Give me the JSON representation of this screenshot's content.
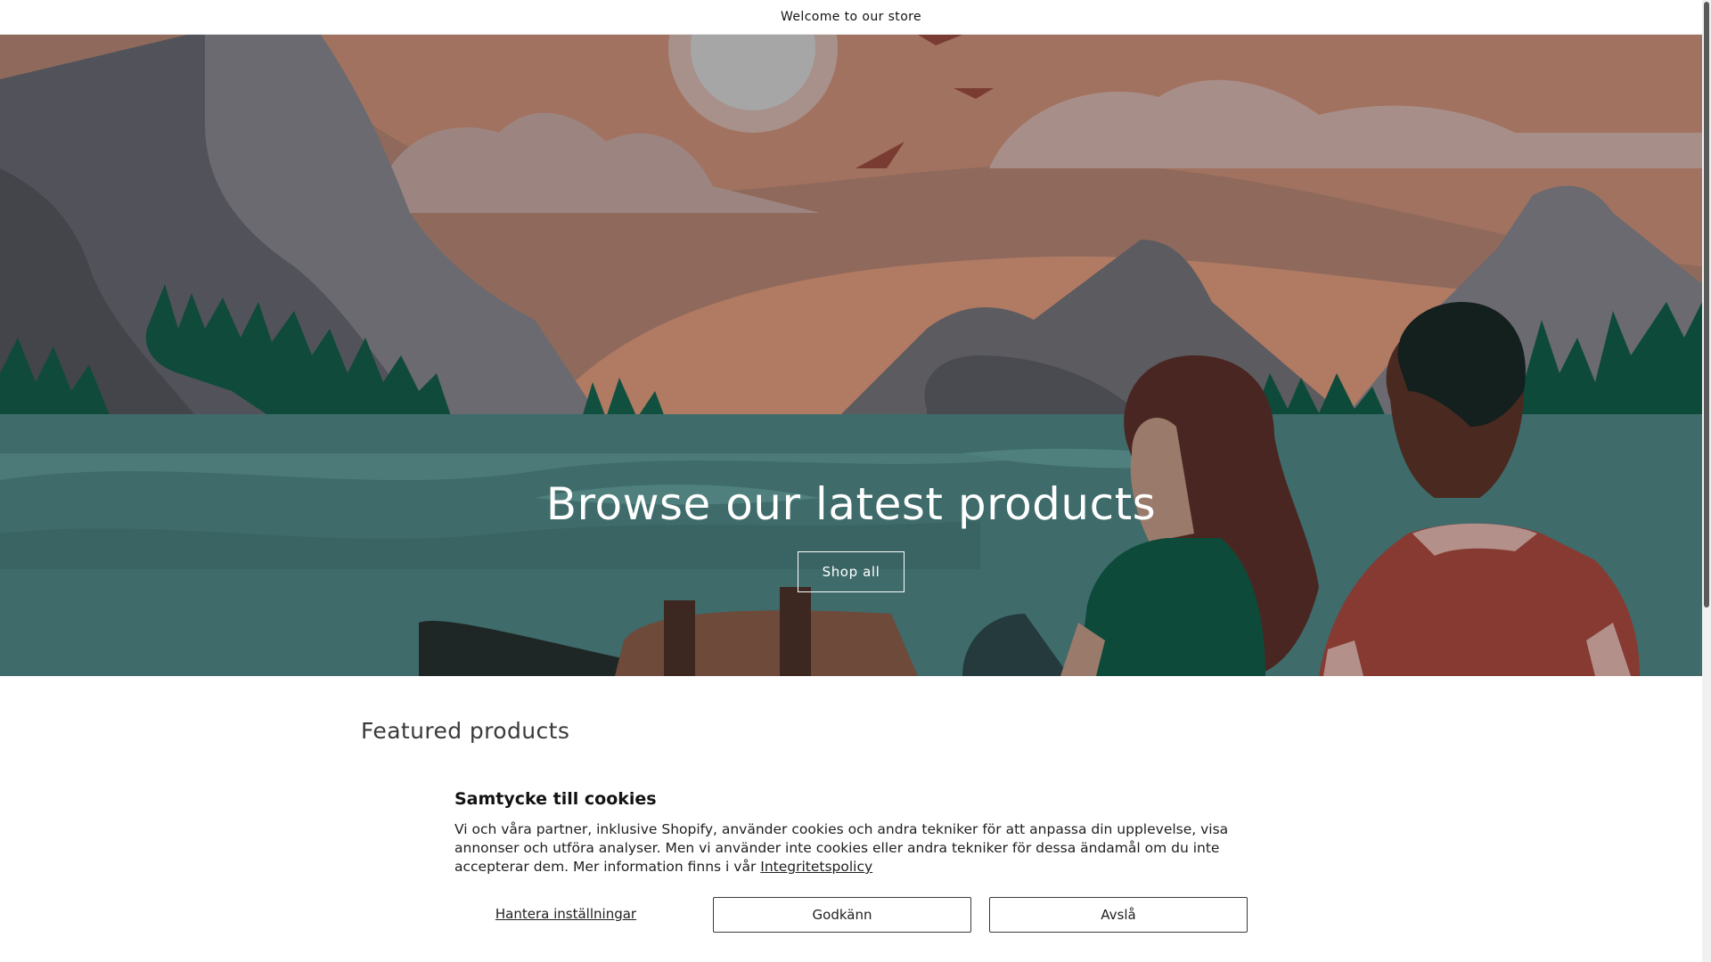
{
  "announcement": {
    "text": "Welcome to our store"
  },
  "hero": {
    "title": "Browse our latest products",
    "button_label": "Shop all"
  },
  "featured": {
    "heading": "Featured products"
  },
  "cookie_banner": {
    "title": "Samtycke till cookies",
    "body": "Vi och våra partner, inklusive Shopify, använder cookies och andra tekniker för att anpassa din upplevelse, visa annonser och utföra analyser. Men vi använder inte cookies eller andra tekniker för dessa ändamål om du inte accepterar dem. Mer information finns i vår ",
    "policy_link": "Integritetspolicy",
    "manage_label": "Hantera inställningar",
    "accept_label": "Godkänn",
    "decline_label": "Avslå"
  },
  "colors": {
    "sky": "#9a6a55",
    "water": "#3f6b6b",
    "mountain": "#5b5b60",
    "trees": "#0d4a3a"
  }
}
